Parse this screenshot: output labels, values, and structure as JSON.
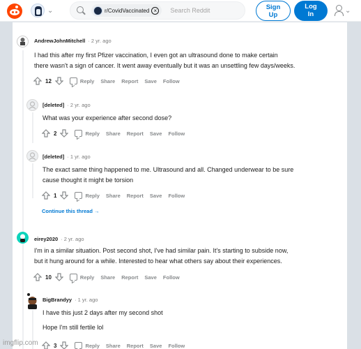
{
  "header": {
    "subreddit_chip": "r/CovidVaccinated",
    "search_placeholder": "Search Reddit",
    "signup_line1": "Sign",
    "signup_line2": "Up",
    "login_line1": "Log",
    "login_line2": "In",
    "chip_close": "×",
    "chevron": "⌄"
  },
  "actions": {
    "reply": "Reply",
    "share": "Share",
    "report": "Report",
    "save": "Save",
    "follow": "Follow"
  },
  "comments": [
    {
      "username": "AndrewJohnMitchell",
      "time": "· 2 yr. ago",
      "body_line1": "I had this after my first Pfizer vaccination, I even got an ultrasound done to make certain",
      "body_line2": "there wasn't a sign of cancer. It went away eventually but it was an unsettling few days/weeks.",
      "score": "12"
    },
    {
      "username": "[deleted]",
      "time": "· 2 yr. ago",
      "body_line1": "What was your experience after second dose?",
      "score": "2"
    },
    {
      "username": "[deleted]",
      "time": "· 1 yr. ago",
      "body_line1": "The exact same thing happened to me. Ultrasound and all. Changed underwear to be sure",
      "body_line2": "cause thought it might be torsion",
      "score": "1"
    },
    {
      "username": "eirey2020",
      "time": "· 2 yr. ago",
      "body_line1": "I'm in a similar situation. Post second shot, I've had similar pain. It's starting to subside now,",
      "body_line2": "but it hung around for a while. Interested to hear what others say about their experiences.",
      "score": "10"
    },
    {
      "username": "BigBrandyy",
      "time": "· 1 yr. ago",
      "body_line1": "I have this just 2 days after my second shot",
      "body_line2": "Hope I'm still fertile lol",
      "score": "3"
    }
  ],
  "continue_thread": "Continue this thread →",
  "watermark": "imgflip.com"
}
